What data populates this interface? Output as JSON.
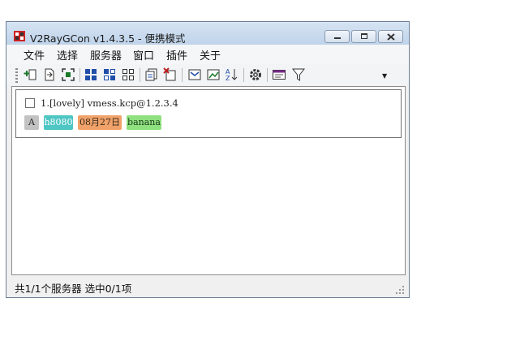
{
  "window": {
    "title": "V2RayGCon v1.4.3.5 - 便携模式"
  },
  "menu": [
    "文件",
    "选择",
    "服务器",
    "窗口",
    "插件",
    "关于"
  ],
  "toolbar": {
    "icons": [
      "add-server-icon",
      "import-icon",
      "scan-qr-icon",
      "select-all-icon",
      "select-invert-icon",
      "select-none-icon",
      "copy-icon",
      "delete-icon",
      "speed-test-icon",
      "latency-icon",
      "sort-icon",
      "settings-icon",
      "log-window-icon",
      "filter-icon"
    ],
    "overflow_glyph": "▼"
  },
  "server": {
    "checked": false,
    "title": "1.[lovely] vmess.kcp@1.2.3.4",
    "tags": [
      {
        "text": "A",
        "bg": "#c2c2c2",
        "fg": "#2a2a2a"
      },
      {
        "text": "h8080",
        "bg": "#4ec6c3",
        "fg": "#ffffff"
      },
      {
        "text": "08月27日",
        "bg": "#f0a26a",
        "fg": "#3a2a1a"
      },
      {
        "text": "banana",
        "bg": "#8fe07f",
        "fg": "#1a3a1a"
      }
    ]
  },
  "status": {
    "text": "共1/1个服务器 选中0/1项"
  }
}
